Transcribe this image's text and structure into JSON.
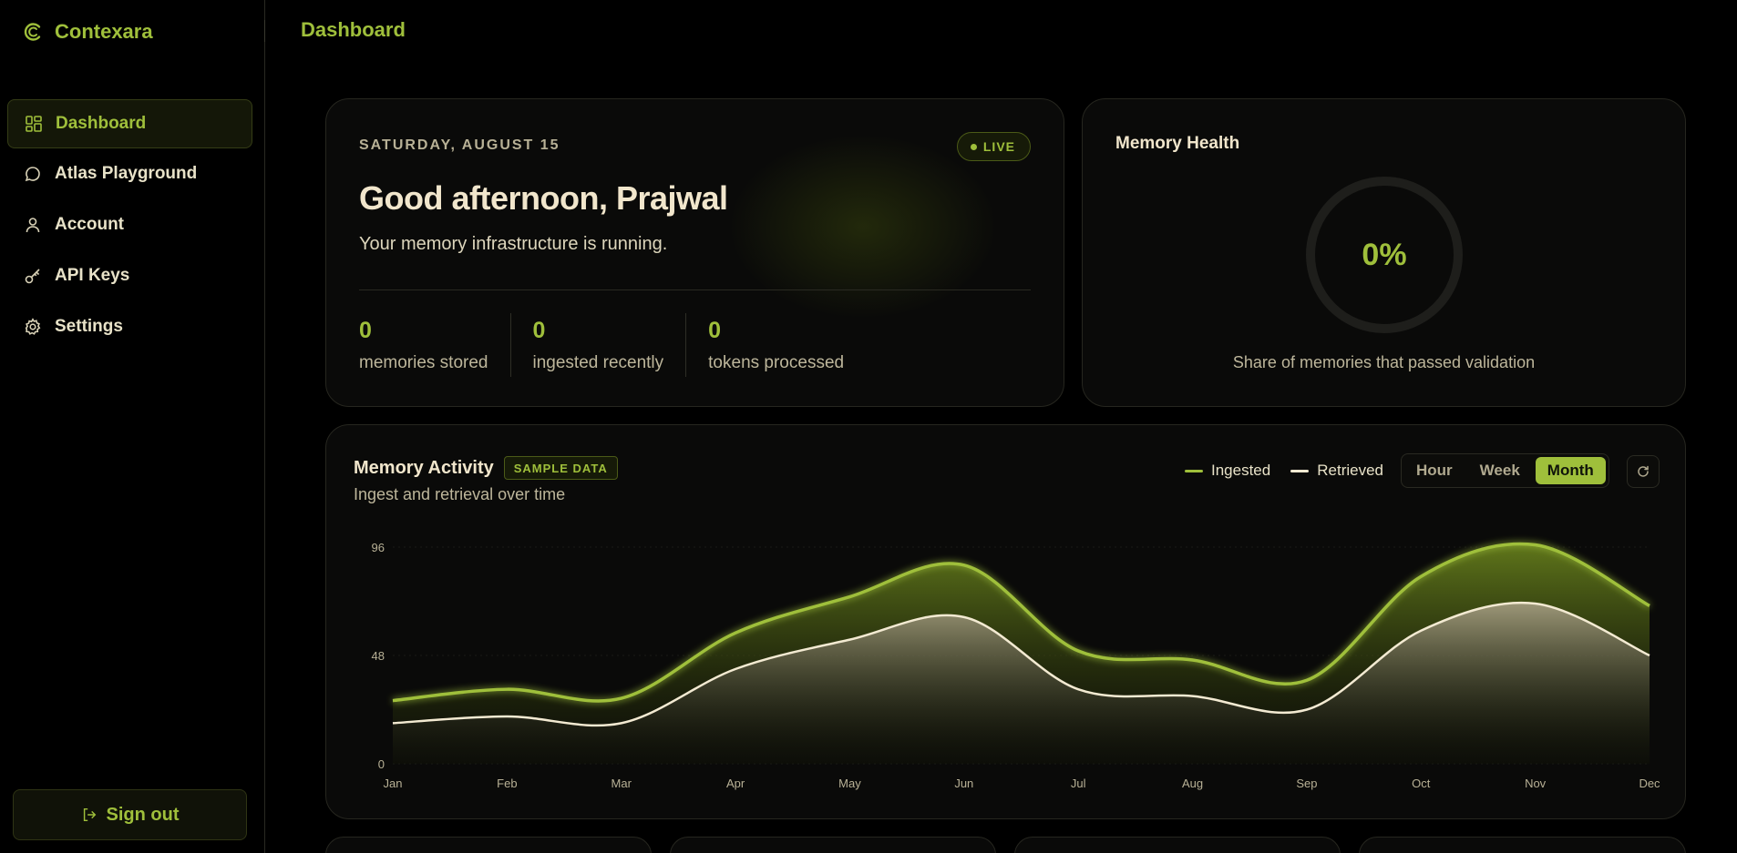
{
  "brand": {
    "name": "Contexara"
  },
  "header": {
    "title": "Dashboard"
  },
  "sidebar": {
    "items": [
      {
        "label": "Dashboard",
        "icon": "dashboard-icon"
      },
      {
        "label": "Atlas Playground",
        "icon": "chat-bubble-icon"
      },
      {
        "label": "Account",
        "icon": "user-icon"
      },
      {
        "label": "API Keys",
        "icon": "key-icon"
      },
      {
        "label": "Settings",
        "icon": "gear-icon"
      }
    ],
    "sign_out": "Sign out"
  },
  "welcome": {
    "date": "SATURDAY, AUGUST 15",
    "live": "LIVE",
    "greeting": "Good afternoon, Prajwal",
    "subtitle": "Your memory infrastructure is running.",
    "stats": [
      {
        "value": "0",
        "label": "memories stored"
      },
      {
        "value": "0",
        "label": "ingested recently"
      },
      {
        "value": "0",
        "label": "tokens processed"
      }
    ]
  },
  "health": {
    "title": "Memory Health",
    "percent": "0%",
    "percent_value": 0,
    "caption": "Share of memories that passed validation"
  },
  "activity": {
    "title": "Memory Activity",
    "badge": "SAMPLE DATA",
    "subtitle": "Ingest and retrieval over time",
    "legend": [
      {
        "name": "Ingested",
        "color": "#9fbf3b"
      },
      {
        "name": "Retrieved",
        "color": "#f3ead2"
      }
    ],
    "ranges": [
      "Hour",
      "Week",
      "Month"
    ],
    "selected_range": "Month"
  },
  "colors": {
    "accent": "#9fbf3b",
    "secondary": "#f3ead2",
    "background": "#000000"
  },
  "chart_data": {
    "type": "area",
    "categories": [
      "Jan",
      "Feb",
      "Mar",
      "Apr",
      "May",
      "Jun",
      "Jul",
      "Aug",
      "Sep",
      "Oct",
      "Nov",
      "Dec"
    ],
    "series": [
      {
        "name": "Ingested",
        "values": [
          28,
          33,
          29,
          58,
          74,
          88,
          50,
          46,
          37,
          83,
          97,
          70
        ]
      },
      {
        "name": "Retrieved",
        "values": [
          18,
          21,
          18,
          42,
          55,
          65,
          33,
          30,
          24,
          59,
          71,
          48
        ]
      }
    ],
    "yticks": [
      "0",
      "48",
      "96"
    ],
    "ylim": [
      0,
      96
    ],
    "grid": true
  }
}
